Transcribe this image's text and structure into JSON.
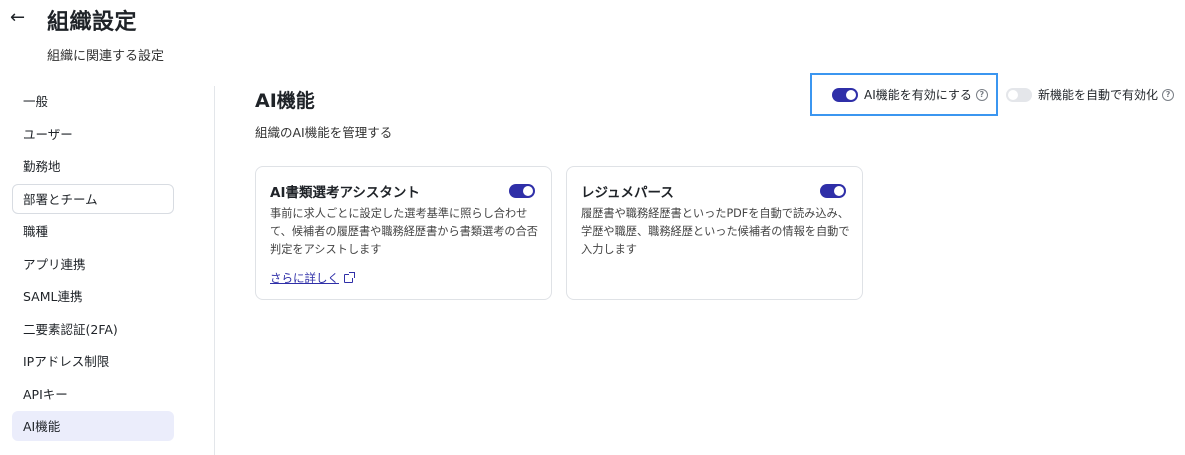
{
  "header": {
    "back_icon": "←",
    "title": "組織設定",
    "subtitle": "組織に関連する設定"
  },
  "sidebar": {
    "items": [
      {
        "label": "一般"
      },
      {
        "label": "ユーザー"
      },
      {
        "label": "勤務地"
      },
      {
        "label": "部署とチーム"
      },
      {
        "label": "職種"
      },
      {
        "label": "アプリ連携"
      },
      {
        "label": "SAML連携"
      },
      {
        "label": "二要素認証(2FA)"
      },
      {
        "label": "IPアドレス制限"
      },
      {
        "label": "APIキー"
      },
      {
        "label": "AI機能"
      }
    ],
    "active": "AI機能"
  },
  "main": {
    "title": "AI機能",
    "subtitle": "組織のAI機能を管理する",
    "toggles": [
      {
        "label": "AI機能を有効にする",
        "help": "?",
        "enabled": true
      },
      {
        "label": "新機能を自動で有効化",
        "help": "?",
        "enabled": false
      }
    ],
    "cards": [
      {
        "title": "AI書類選考アシスタント",
        "enabled": true,
        "description": "事前に求人ごとに設定した選考基準に照らし合わせて、候補者の履歴書や職務経歴書から書類選考の合否判定をアシストします",
        "link": "さらに詳しく"
      },
      {
        "title": "レジュメパース",
        "enabled": true,
        "description": "履歴書や職務経歴書といったPDFを自動で読み込み、学歴や職歴、職務経歴といった候補者の情報を自動で入力します"
      }
    ]
  },
  "colors": {
    "accent": "#2f2fa8",
    "focus_outline": "#3b96f0",
    "active_bg": "#ebedfb"
  }
}
